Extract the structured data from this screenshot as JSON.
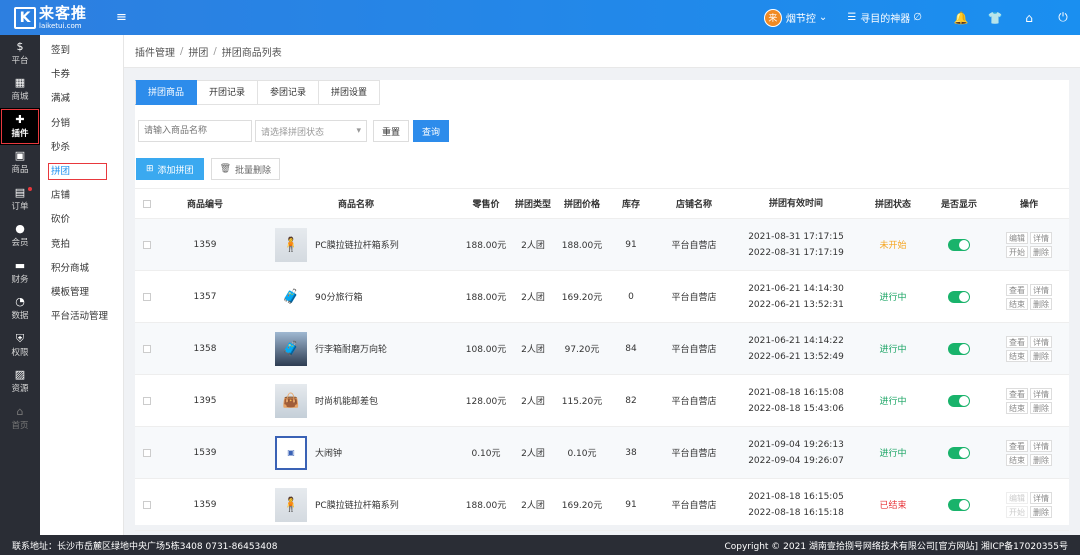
{
  "brand": {
    "name_cn": "来客推",
    "domain": "laiketui.com",
    "logo_letter": "K"
  },
  "header": {
    "user_initial": "来",
    "user_name": "烟节控",
    "user_caret": "⌄",
    "tool_name": "寻目的神器",
    "tool_suffix": "∅",
    "icons": [
      "bell-icon",
      "shirt-icon",
      "home-icon",
      "power-icon"
    ]
  },
  "sidenav": [
    {
      "label": "平台",
      "icon": "$"
    },
    {
      "label": "商城",
      "icon": "▦"
    },
    {
      "label": "插件",
      "icon": "✚",
      "active": true
    },
    {
      "label": "商品",
      "icon": "▣"
    },
    {
      "label": "订单",
      "icon": "▤",
      "dot": true
    },
    {
      "label": "会员",
      "icon": "●"
    },
    {
      "label": "财务",
      "icon": "▬"
    },
    {
      "label": "数据",
      "icon": "◔"
    },
    {
      "label": "权限",
      "icon": "⛨"
    },
    {
      "label": "资源",
      "icon": "▨"
    },
    {
      "label": "首页",
      "icon": "⌂",
      "dim": true
    }
  ],
  "subnav": [
    {
      "label": "签到"
    },
    {
      "label": "卡券"
    },
    {
      "label": "满减"
    },
    {
      "label": "分销"
    },
    {
      "label": "秒杀"
    },
    {
      "label": "拼团",
      "active": true
    },
    {
      "label": "店铺"
    },
    {
      "label": "砍价"
    },
    {
      "label": "竞拍"
    },
    {
      "label": "积分商城"
    },
    {
      "label": "模板管理"
    },
    {
      "label": "平台活动管理"
    }
  ],
  "breadcrumb": [
    "插件管理",
    "拼团",
    "拼团商品列表"
  ],
  "tabs": [
    {
      "label": "拼团商品",
      "active": true
    },
    {
      "label": "开团记录"
    },
    {
      "label": "参团记录"
    },
    {
      "label": "拼团设置"
    }
  ],
  "filters": {
    "name_placeholder": "请输入商品名称",
    "status_placeholder": "请选择拼团状态",
    "reset_label": "重置",
    "search_label": "查询"
  },
  "actions": {
    "add_label": "添加拼团",
    "bulk_delete_label": "批量删除"
  },
  "table": {
    "headers": {
      "id": "商品编号",
      "name": "商品名称",
      "price": "零售价",
      "type": "拼团类型",
      "group_price": "拼团价格",
      "stock": "库存",
      "shop": "店铺名称",
      "period": "拼团有效时间",
      "status": "拼团状态",
      "show": "是否显示",
      "ops": "操作"
    },
    "rows": [
      {
        "id": "1359",
        "name": "PC膜拉链拉杆箱系列",
        "price": "188.00元",
        "type": "2人团",
        "group_price": "188.00元",
        "stock": "91",
        "shop": "平台自营店",
        "start": "2021-08-31 17:17:15",
        "end": "2022-08-31 17:17:19",
        "status": "未开始",
        "status_kind": "ns",
        "ops1": [
          "编辑",
          "详情"
        ],
        "ops2": [
          "开始",
          "删除"
        ],
        "img": "img-a",
        "glyph": "🧍"
      },
      {
        "id": "1357",
        "name": "90分旅行箱",
        "price": "188.00元",
        "type": "2人团",
        "group_price": "169.20元",
        "stock": "0",
        "shop": "平台自营店",
        "start": "2021-06-21 14:14:30",
        "end": "2022-06-21 13:52:31",
        "status": "进行中",
        "status_kind": "on",
        "ops1": [
          "查看",
          "详情"
        ],
        "ops2": [
          "结束",
          "删除"
        ],
        "img": "img-b",
        "glyph": "🧳"
      },
      {
        "id": "1358",
        "name": "行李箱耐磨万向轮",
        "price": "108.00元",
        "type": "2人团",
        "group_price": "97.20元",
        "stock": "84",
        "shop": "平台自营店",
        "start": "2021-06-21 14:14:22",
        "end": "2022-06-21 13:52:49",
        "status": "进行中",
        "status_kind": "on",
        "ops1": [
          "查看",
          "详情"
        ],
        "ops2": [
          "结束",
          "删除"
        ],
        "img": "img-c",
        "glyph": "🧳"
      },
      {
        "id": "1395",
        "name": "时尚机能邮差包",
        "price": "128.00元",
        "type": "2人团",
        "group_price": "115.20元",
        "stock": "82",
        "shop": "平台自营店",
        "start": "2021-08-18 16:15:08",
        "end": "2022-08-18 15:43:06",
        "status": "进行中",
        "status_kind": "on",
        "ops1": [
          "查看",
          "详情"
        ],
        "ops2": [
          "结束",
          "删除"
        ],
        "img": "img-d",
        "glyph": "👜"
      },
      {
        "id": "1539",
        "name": "大闹钟",
        "price": "0.10元",
        "type": "2人团",
        "group_price": "0.10元",
        "stock": "38",
        "shop": "平台自营店",
        "start": "2021-09-04 19:26:13",
        "end": "2022-09-04 19:26:07",
        "status": "进行中",
        "status_kind": "on",
        "ops1": [
          "查看",
          "详情"
        ],
        "ops2": [
          "结束",
          "删除"
        ],
        "img": "img-e",
        "glyph": "▣"
      },
      {
        "id": "1359",
        "name": "PC膜拉链拉杆箱系列",
        "price": "188.00元",
        "type": "2人团",
        "group_price": "169.20元",
        "stock": "91",
        "shop": "平台自营店",
        "start": "2021-08-18 16:15:05",
        "end": "2022-08-18 16:15:18",
        "status": "已结束",
        "status_kind": "end",
        "ops1": [
          "编辑",
          "详情"
        ],
        "ops2": [
          "开始",
          "删除"
        ],
        "img": "img-a",
        "glyph": "🧍"
      }
    ]
  },
  "footer": {
    "address": "联系地址：长沙市岳麓区绿地中央广场5栋3408 0731-86453408",
    "copyright": "Copyright © 2021 湖南壹拾捌号网络技术有限公司[官方网站] 湘ICP备17020355号"
  }
}
